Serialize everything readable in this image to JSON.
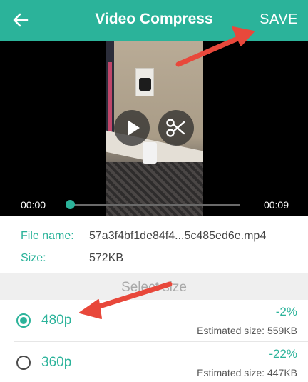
{
  "app": {
    "title": "Video Compress",
    "back_icon": "arrow-left-icon",
    "save_label": "SAVE",
    "accent_color": "#2bb39a"
  },
  "player": {
    "current_time": "00:00",
    "duration": "00:09",
    "progress": 0.0,
    "play_icon": "play-icon",
    "trim_icon": "scissors-icon"
  },
  "file": {
    "name_label": "File name:",
    "name_value": "57a3f4bf1de84f4...5c485ed6e.mp4",
    "size_label": "Size:",
    "size_value": "572KB"
  },
  "size_selector": {
    "heading": "Select size",
    "options": [
      {
        "resolution": "480p",
        "change": "-2%",
        "estimate": "Estimated size: 559KB",
        "selected": true
      },
      {
        "resolution": "360p",
        "change": "-22%",
        "estimate": "Estimated size: 447KB",
        "selected": false
      }
    ]
  },
  "annotations": {
    "arrow_color": "#e8483b"
  }
}
